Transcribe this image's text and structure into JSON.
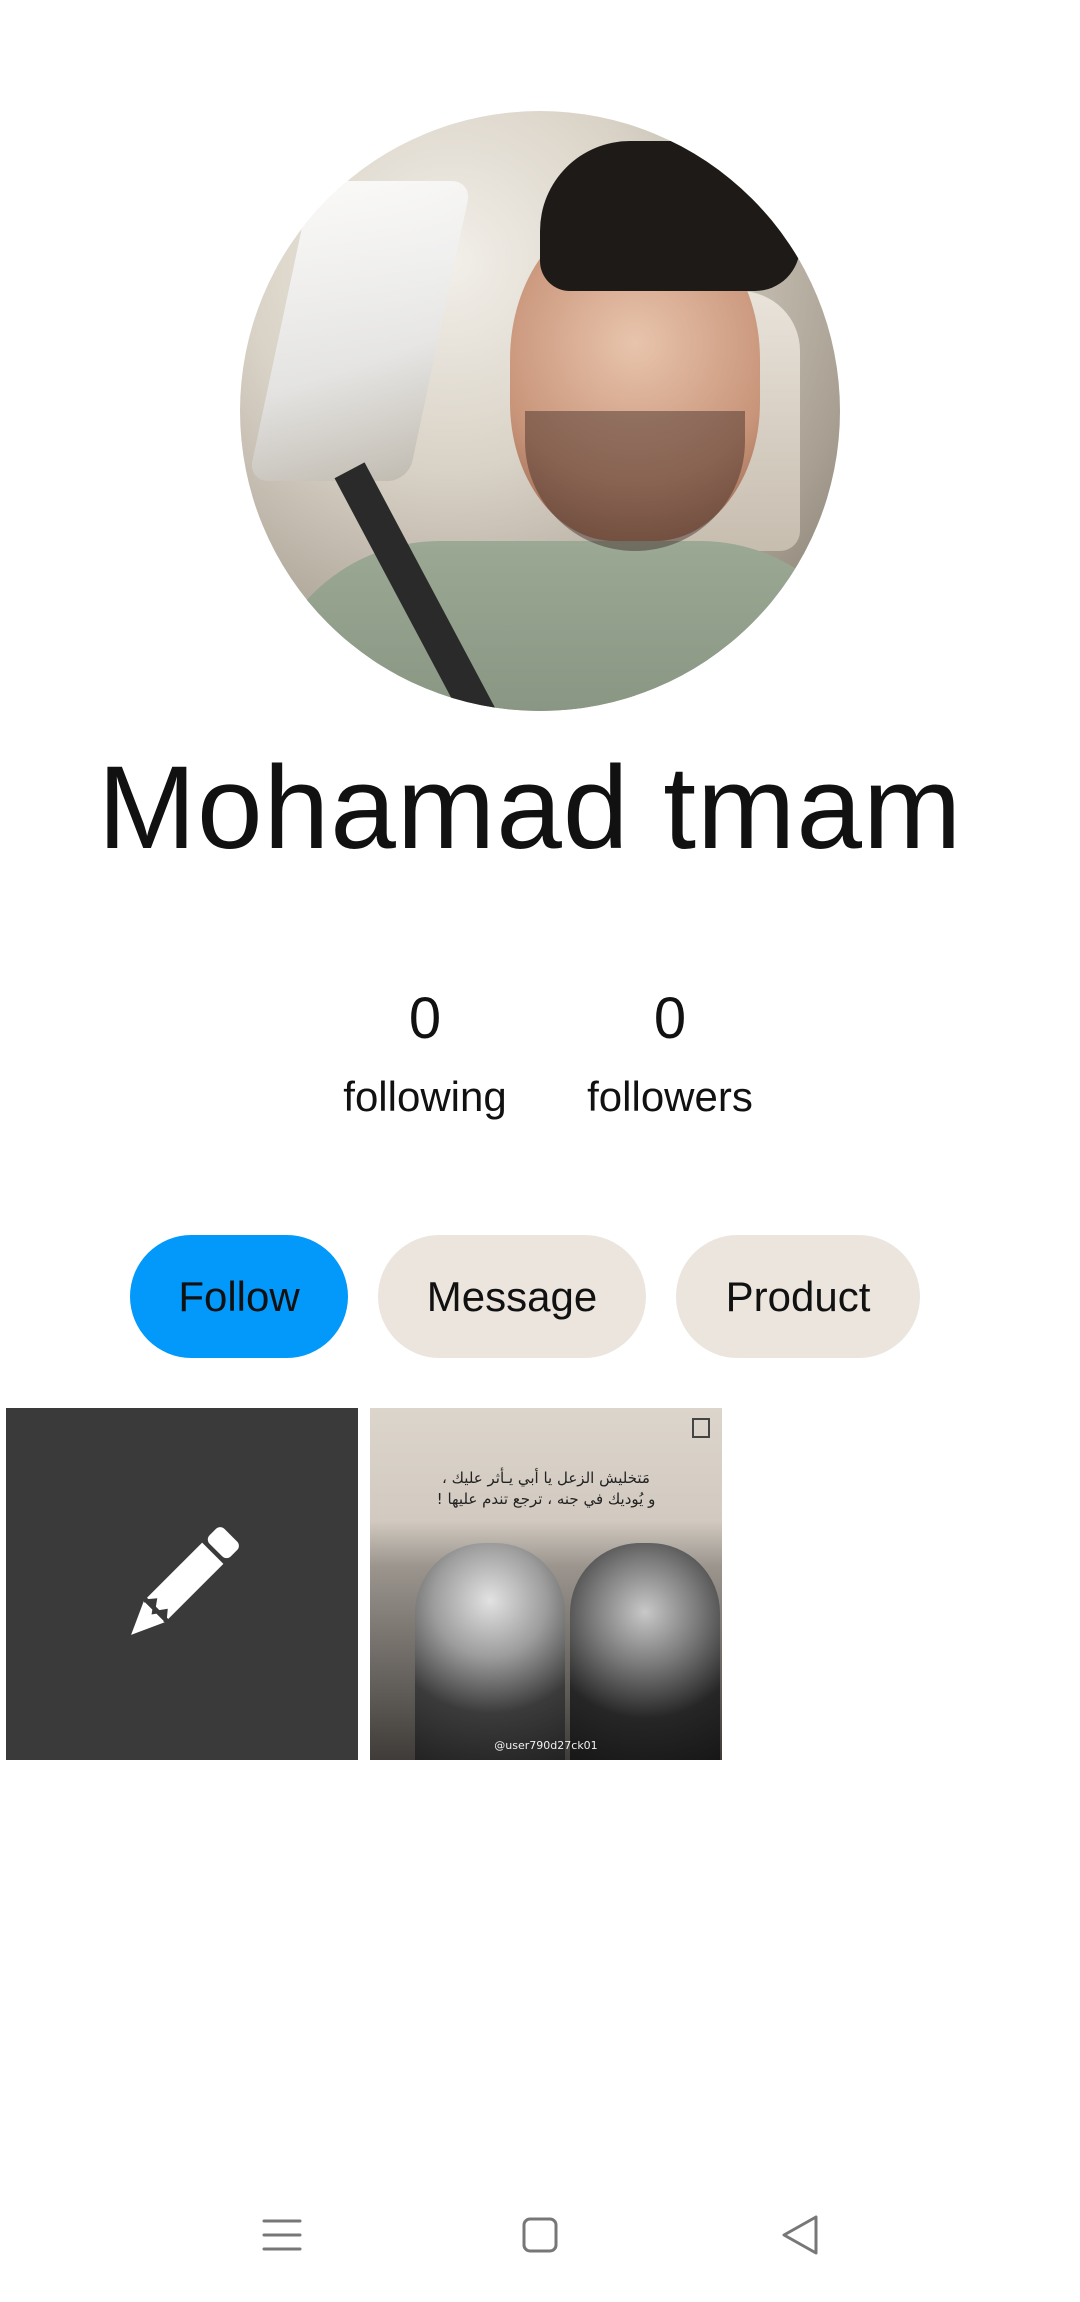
{
  "profile": {
    "name": "Mohamad tmam"
  },
  "stats": {
    "following": {
      "count": "0",
      "label": "following"
    },
    "followers": {
      "count": "0",
      "label": "followers"
    }
  },
  "actions": {
    "follow": "Follow",
    "message": "Message",
    "product": "Product"
  },
  "posts": {
    "edit_icon": "pencil-icon",
    "post1": {
      "caption_line1": "مَتخليش الزعل يا أبي يـأثر عليك ،",
      "caption_line2": "و يُوديك في جنه ، ترجع تندم عليها !",
      "watermark": "@user790d27ck01"
    }
  },
  "system_nav": {
    "menu_icon": "menu-icon",
    "home_icon": "home-square-icon",
    "back_icon": "back-triangle-icon"
  },
  "colors": {
    "follow_button": "#0299fb",
    "secondary_button": "#ebe5de",
    "edit_tile": "#3a3a3a"
  }
}
